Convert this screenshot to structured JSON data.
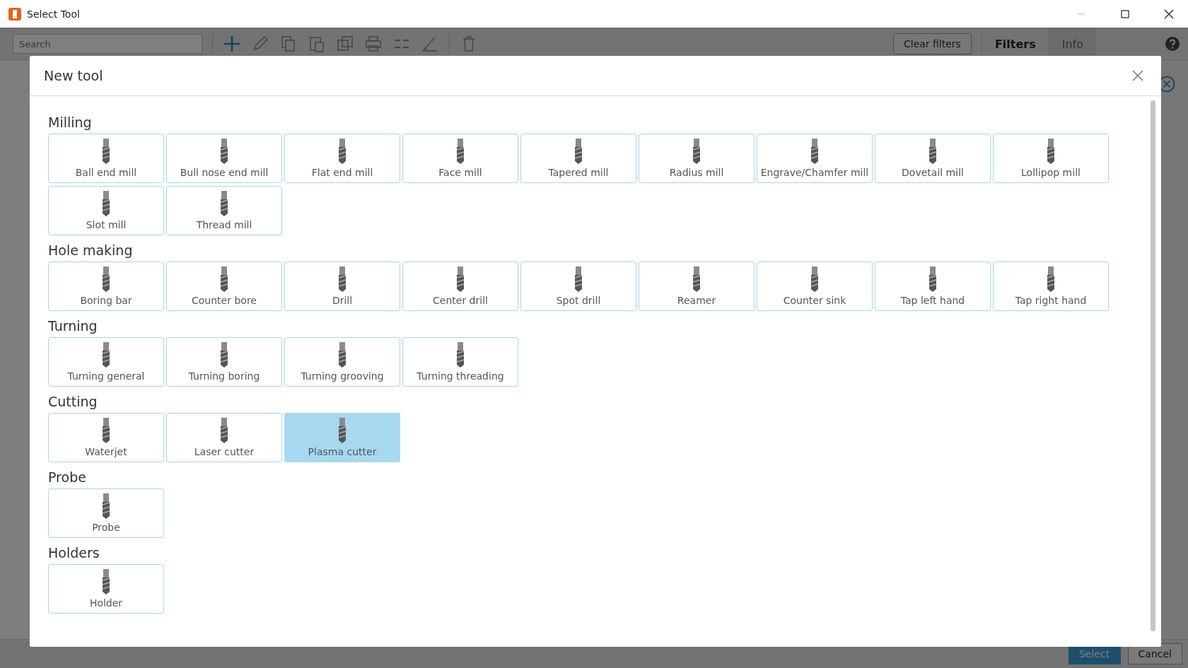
{
  "window": {
    "title": "Select Tool"
  },
  "toolbar": {
    "search": {
      "placeholder": "Search"
    },
    "clear_filters": "Clear filters",
    "tabs": [
      {
        "label": "Filters",
        "selected": true
      },
      {
        "label": "Info",
        "selected": false
      }
    ]
  },
  "footer": {
    "buttons": [
      {
        "label": "Select",
        "kind": "primary"
      },
      {
        "label": "Cancel",
        "kind": "secondary"
      }
    ]
  },
  "dialog": {
    "title": "New tool",
    "sections": [
      {
        "title": "Milling",
        "tools": [
          {
            "label": "Ball end mill",
            "selected": false
          },
          {
            "label": "Bull nose end mill",
            "selected": false
          },
          {
            "label": "Flat end mill",
            "selected": false
          },
          {
            "label": "Face mill",
            "selected": false
          },
          {
            "label": "Tapered mill",
            "selected": false
          },
          {
            "label": "Radius mill",
            "selected": false
          },
          {
            "label": "Engrave/Chamfer mill",
            "selected": false
          },
          {
            "label": "Dovetail mill",
            "selected": false
          },
          {
            "label": "Lollipop mill",
            "selected": false
          },
          {
            "label": "Slot mill",
            "selected": false
          },
          {
            "label": "Thread mill",
            "selected": false
          }
        ]
      },
      {
        "title": "Hole making",
        "tools": [
          {
            "label": "Boring bar",
            "selected": false
          },
          {
            "label": "Counter bore",
            "selected": false
          },
          {
            "label": "Drill",
            "selected": false
          },
          {
            "label": "Center drill",
            "selected": false
          },
          {
            "label": "Spot drill",
            "selected": false
          },
          {
            "label": "Reamer",
            "selected": false
          },
          {
            "label": "Counter sink",
            "selected": false
          },
          {
            "label": "Tap left hand",
            "selected": false
          },
          {
            "label": "Tap right hand",
            "selected": false
          }
        ]
      },
      {
        "title": "Turning",
        "tools": [
          {
            "label": "Turning general",
            "selected": false
          },
          {
            "label": "Turning boring",
            "selected": false
          },
          {
            "label": "Turning grooving",
            "selected": false
          },
          {
            "label": "Turning threading",
            "selected": false
          }
        ]
      },
      {
        "title": "Cutting",
        "tools": [
          {
            "label": "Waterjet",
            "selected": false
          },
          {
            "label": "Laser cutter",
            "selected": false
          },
          {
            "label": "Plasma cutter",
            "selected": true
          }
        ]
      },
      {
        "title": "Probe",
        "tools": [
          {
            "label": "Probe",
            "selected": false
          }
        ]
      },
      {
        "title": "Holders",
        "tools": [
          {
            "label": "Holder",
            "selected": false
          }
        ]
      }
    ]
  }
}
